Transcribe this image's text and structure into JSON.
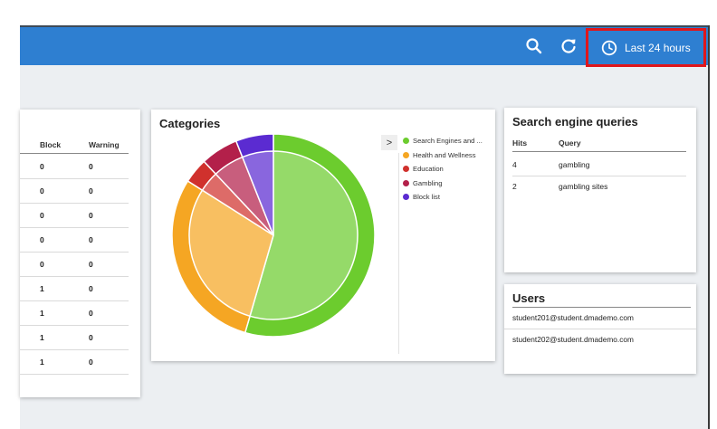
{
  "header": {
    "time_range_label": "Last 24 hours",
    "search_icon": "search-icon",
    "refresh_icon": "refresh-icon",
    "clock_icon": "clock-icon",
    "bar_color": "#2e7fd1",
    "highlight_color": "#e0161b"
  },
  "left_table": {
    "columns": [
      "Block",
      "Warning"
    ],
    "rows": [
      [
        "0",
        "0"
      ],
      [
        "0",
        "0"
      ],
      [
        "0",
        "0"
      ],
      [
        "0",
        "0"
      ],
      [
        "0",
        "0"
      ],
      [
        "1",
        "0"
      ],
      [
        "1",
        "0"
      ],
      [
        "1",
        "0"
      ],
      [
        "1",
        "0"
      ]
    ]
  },
  "categories": {
    "title": "Categories",
    "legend_toggle": ">",
    "items": [
      {
        "label": "Search Engines and ...",
        "color": "#6ccc2e",
        "share": 0.545
      },
      {
        "label": "Health and Wellness",
        "color": "#f5a623",
        "share": 0.295
      },
      {
        "label": "Education",
        "color": "#d0312d",
        "share": 0.04
      },
      {
        "label": "Gambling",
        "color": "#b3204a",
        "share": 0.06
      },
      {
        "label": "Block list",
        "color": "#5b2bd1",
        "share": 0.06
      }
    ]
  },
  "search_queries": {
    "title": "Search engine queries",
    "columns": [
      "Hits",
      "Query"
    ],
    "rows": [
      {
        "hits": "4",
        "query": "gambling"
      },
      {
        "hits": "2",
        "query": "gambling sites"
      }
    ]
  },
  "users": {
    "title": "Users",
    "items": [
      "student201@student.dmademo.com",
      "student202@student.dmademo.com"
    ]
  }
}
